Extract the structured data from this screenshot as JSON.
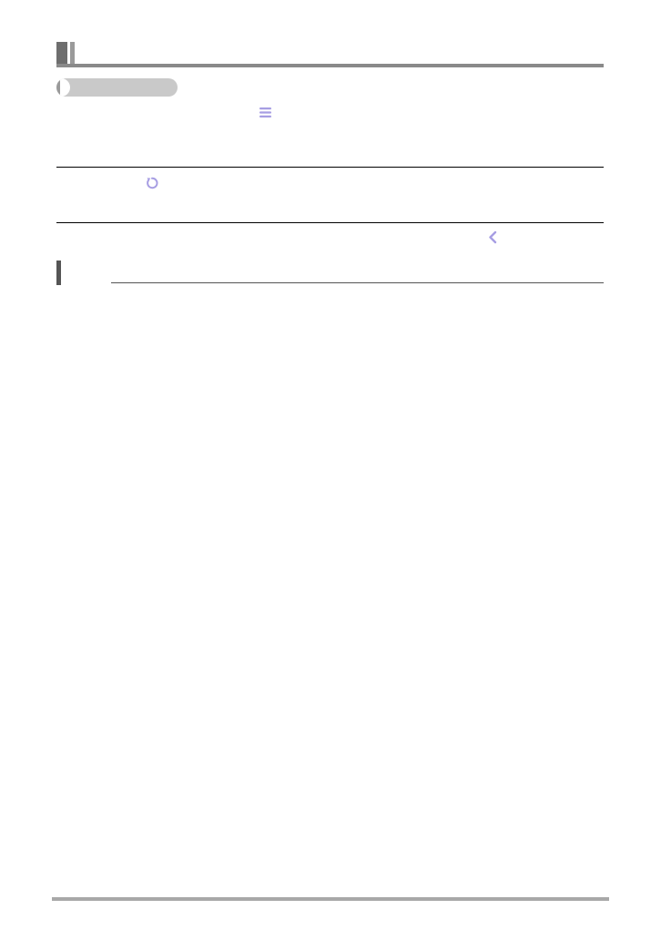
{
  "icons": {
    "menu": "menu-icon",
    "rotate": "rotate-icon",
    "chevron_left": "chevron-left-icon"
  },
  "colors": {
    "icon_accent": "#a79ee3",
    "header_dark": "#6e6e6e",
    "header_light": "#9a9a9a",
    "pill": "#c9c9c9",
    "rule": "#000000",
    "footer": "#a8a8a8"
  }
}
